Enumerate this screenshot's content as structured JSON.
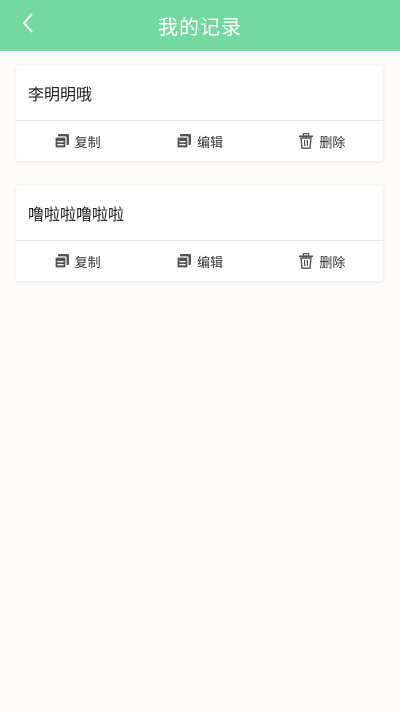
{
  "header": {
    "title": "我的记录",
    "back_icon": "chevron-left-icon"
  },
  "records": [
    {
      "title": "李明明哦",
      "actions": {
        "copy": "复制",
        "edit": "编辑",
        "delete": "删除"
      }
    },
    {
      "title": "噜啦啦噜啦啦",
      "actions": {
        "copy": "复制",
        "edit": "编辑",
        "delete": "删除"
      }
    }
  ],
  "colors": {
    "header_bg": "#74d9a0",
    "page_bg": "#fdfcfa",
    "icon": "#555555"
  }
}
